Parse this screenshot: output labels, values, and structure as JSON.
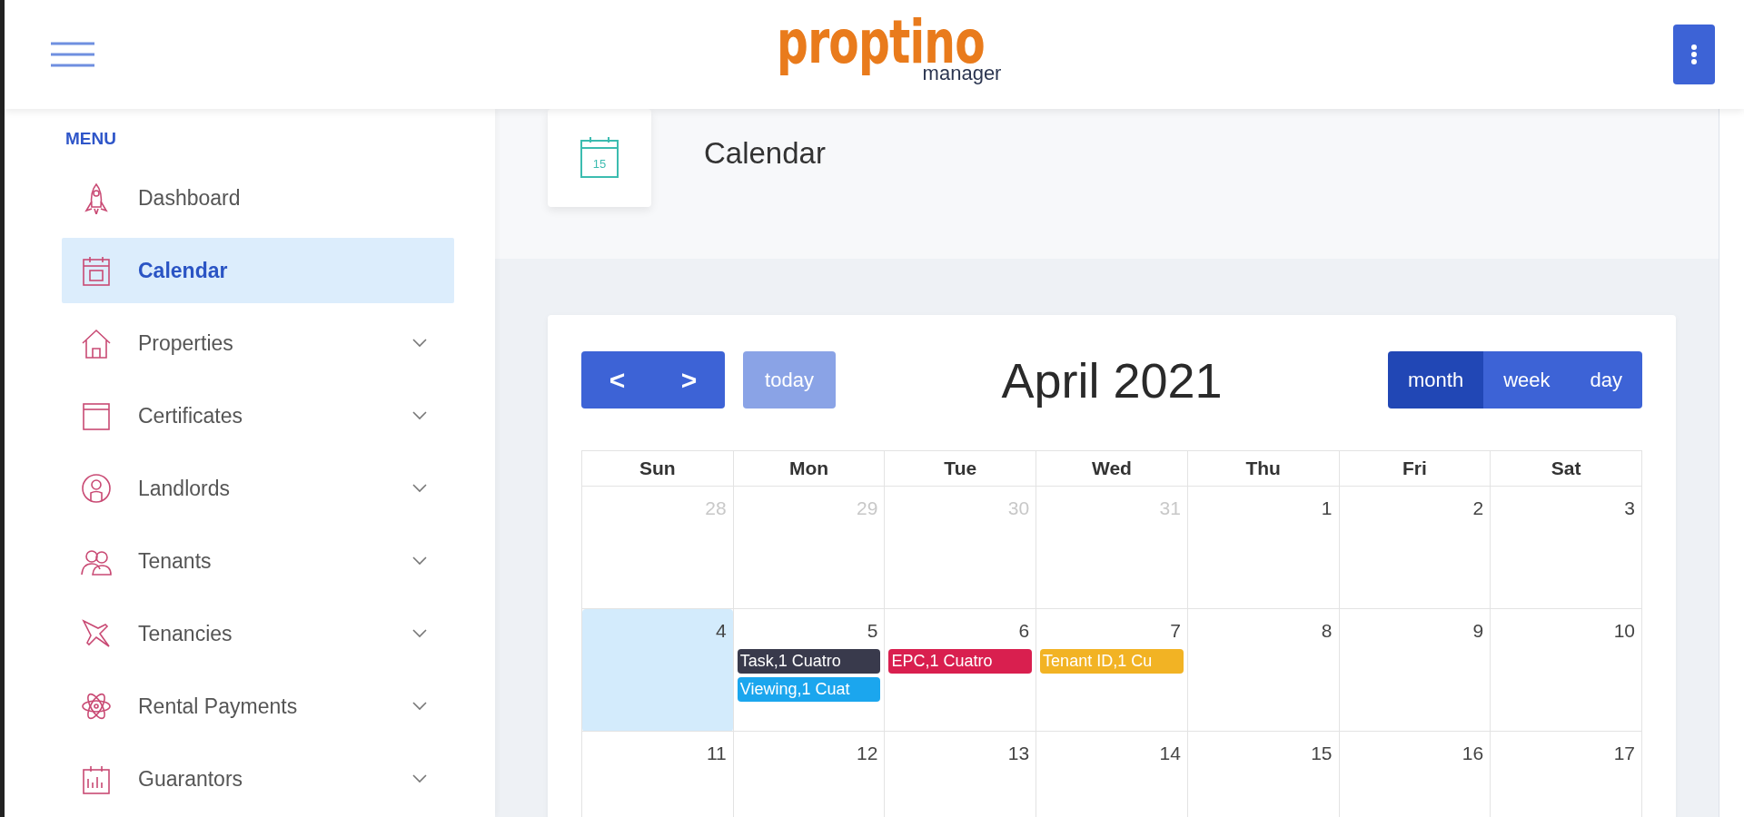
{
  "header": {
    "logo": {
      "name": "proptino",
      "tagline": "manager"
    }
  },
  "sidebar": {
    "title": "MENU",
    "items": [
      {
        "label": "Dashboard",
        "selected": false,
        "expandable": false
      },
      {
        "label": "Calendar",
        "selected": true,
        "expandable": false
      },
      {
        "label": "Properties",
        "selected": false,
        "expandable": true
      },
      {
        "label": "Certificates",
        "selected": false,
        "expandable": true
      },
      {
        "label": "Landlords",
        "selected": false,
        "expandable": true
      },
      {
        "label": "Tenants",
        "selected": false,
        "expandable": true
      },
      {
        "label": "Tenancies",
        "selected": false,
        "expandable": true
      },
      {
        "label": "Rental Payments",
        "selected": false,
        "expandable": true
      },
      {
        "label": "Guarantors",
        "selected": false,
        "expandable": true
      }
    ]
  },
  "page_title": {
    "icon_day": "15",
    "title": "Calendar"
  },
  "calendar": {
    "prev": "<",
    "next": ">",
    "today": {
      "label": "today",
      "disabled": true
    },
    "title": "April 2021",
    "views": [
      {
        "label": "month",
        "selected": true
      },
      {
        "label": "week",
        "selected": false
      },
      {
        "label": "day",
        "selected": false
      }
    ],
    "weekdays": [
      "Sun",
      "Mon",
      "Tue",
      "Wed",
      "Thu",
      "Fri",
      "Sat"
    ],
    "weeks": [
      [
        {
          "day": "28",
          "other_month": true,
          "today": false
        },
        {
          "day": "29",
          "other_month": true,
          "today": false
        },
        {
          "day": "30",
          "other_month": true,
          "today": false
        },
        {
          "day": "31",
          "other_month": true,
          "today": false
        },
        {
          "day": "1",
          "other_month": false,
          "today": false
        },
        {
          "day": "2",
          "other_month": false,
          "today": false
        },
        {
          "day": "3",
          "other_month": false,
          "today": false
        }
      ],
      [
        {
          "day": "4",
          "other_month": false,
          "today": true
        },
        {
          "day": "5",
          "other_month": false,
          "today": false,
          "events": [
            {
              "text": "Task,1 Cuatro",
              "color": "#393a4c"
            },
            {
              "text": "Viewing,1 Cuat",
              "color": "#1ba6ee"
            }
          ]
        },
        {
          "day": "6",
          "other_month": false,
          "today": false,
          "events": [
            {
              "text": "EPC,1 Cuatro",
              "color": "#d91f4f"
            }
          ]
        },
        {
          "day": "7",
          "other_month": false,
          "today": false,
          "events": [
            {
              "text": "Tenant ID,1 Cu",
              "color": "#f2b324"
            }
          ]
        },
        {
          "day": "8",
          "other_month": false,
          "today": false
        },
        {
          "day": "9",
          "other_month": false,
          "today": false
        },
        {
          "day": "10",
          "other_month": false,
          "today": false
        }
      ],
      [
        {
          "day": "11",
          "other_month": false,
          "today": false
        },
        {
          "day": "12",
          "other_month": false,
          "today": false
        },
        {
          "day": "13",
          "other_month": false,
          "today": false
        },
        {
          "day": "14",
          "other_month": false,
          "today": false
        },
        {
          "day": "15",
          "other_month": false,
          "today": false
        },
        {
          "day": "16",
          "other_month": false,
          "today": false
        },
        {
          "day": "17",
          "other_month": false,
          "today": false
        }
      ]
    ]
  }
}
